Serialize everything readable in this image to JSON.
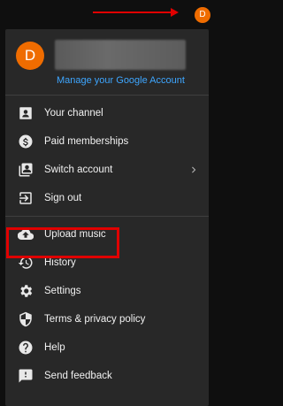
{
  "topbar": {
    "avatar_letter": "D"
  },
  "account": {
    "avatar_letter": "D",
    "manage_label": "Manage your Google Account"
  },
  "sections": [
    {
      "items": [
        {
          "label": "Your channel",
          "icon": "person-box-icon"
        },
        {
          "label": "Paid memberships",
          "icon": "dollar-circle-icon"
        },
        {
          "label": "Switch account",
          "icon": "switch-account-icon",
          "has_submenu": true
        },
        {
          "label": "Sign out",
          "icon": "sign-out-icon"
        }
      ]
    },
    {
      "items": [
        {
          "label": "Upload music",
          "icon": "cloud-upload-icon"
        },
        {
          "label": "History",
          "icon": "history-icon"
        },
        {
          "label": "Settings",
          "icon": "gear-icon"
        },
        {
          "label": "Terms & privacy policy",
          "icon": "shield-icon"
        },
        {
          "label": "Help",
          "icon": "help-icon"
        },
        {
          "label": "Send feedback",
          "icon": "feedback-icon"
        }
      ]
    }
  ],
  "colors": {
    "accent_link": "#3ea6ff",
    "avatar": "#ef6c00",
    "annotation": "#e00000",
    "menu_bg": "#282828"
  }
}
